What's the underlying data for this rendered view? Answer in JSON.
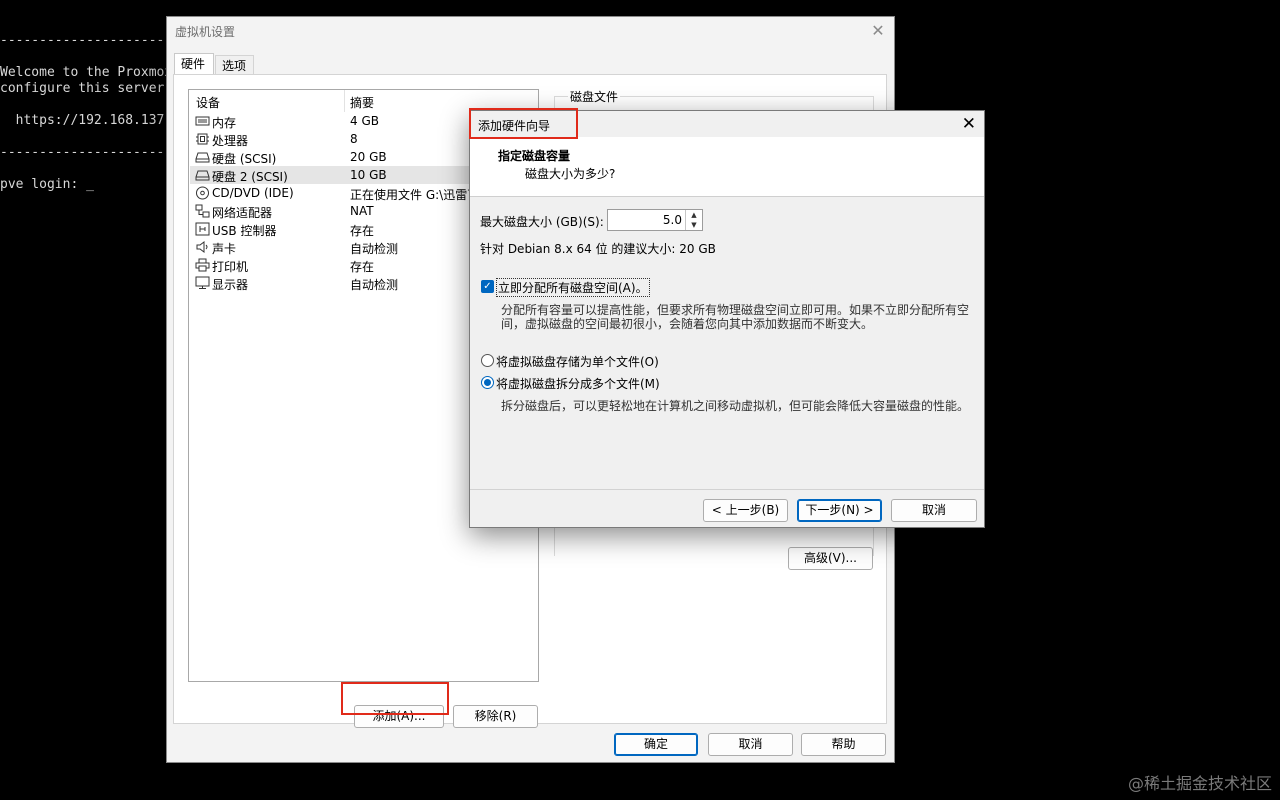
{
  "terminal": {
    "lines": [
      "--------------------------------",
      "Welcome to the Proxmox",
      "configure this server",
      "  https://192.168.137",
      "--------------------------------",
      "pve login: _"
    ]
  },
  "settings_window": {
    "title": "虚拟机设置",
    "tabs": [
      {
        "label": "硬件"
      },
      {
        "label": "选项"
      }
    ],
    "columns": {
      "device": "设备",
      "summary": "摘要"
    },
    "devices": [
      {
        "name": "内存",
        "summary": "4 GB",
        "icon": "memory-icon"
      },
      {
        "name": "处理器",
        "summary": "8",
        "icon": "cpu-icon"
      },
      {
        "name": "硬盘 (SCSI)",
        "summary": "20 GB",
        "icon": "hard-disk-icon"
      },
      {
        "name": "硬盘 2 (SCSI)",
        "summary": "10 GB",
        "icon": "hard-disk-icon"
      },
      {
        "name": "CD/DVD (IDE)",
        "summary": "正在使用文件 G:\\迅雷下",
        "icon": "cd-dvd-icon"
      },
      {
        "name": "网络适配器",
        "summary": "NAT",
        "icon": "network-icon"
      },
      {
        "name": "USB 控制器",
        "summary": "存在",
        "icon": "usb-icon"
      },
      {
        "name": "声卡",
        "summary": "自动检测",
        "icon": "speaker-icon"
      },
      {
        "name": "打印机",
        "summary": "存在",
        "icon": "printer-icon"
      },
      {
        "name": "显示器",
        "summary": "自动检测",
        "icon": "monitor-icon"
      }
    ],
    "disk_file_group": "磁盘文件",
    "advanced_button": "高级(V)...",
    "add_button": "添加(A)...",
    "remove_button": "移除(R)",
    "ok_button": "确定",
    "cancel_button": "取消",
    "help_button": "帮助"
  },
  "wizard": {
    "title": "添加硬件向导",
    "heading": "指定磁盘容量",
    "subheading": "磁盘大小为多少?",
    "max_size_label": "最大磁盘大小 (GB)(S):",
    "max_size_value": "5.0",
    "recommend_text": "针对 Debian 8.x 64 位 的建议大小: 20 GB",
    "allocate_label": "立即分配所有磁盘空间(A)。",
    "allocate_checked": true,
    "allocate_desc_1": "分配所有容量可以提高性能，但要求所有物理磁盘空间立即可用。如果不立即分配所有空",
    "allocate_desc_2": "间，虚拟磁盘的空间最初很小，会随着您向其中添加数据而不断变大。",
    "single_file_label": "将虚拟磁盘存储为单个文件(O)",
    "multi_file_label": "将虚拟磁盘拆分成多个文件(M)",
    "multi_file_desc": "拆分磁盘后，可以更轻松地在计算机之间移动虚拟机，但可能会降低大容量磁盘的性能。",
    "back_button": "< 上一步(B)",
    "next_button": "下一步(N) >",
    "cancel_button": "取消"
  },
  "watermark": "@稀土掘金技术社区",
  "colors": {
    "accent": "#0067c0",
    "highlight_box": "#e02a1a"
  }
}
